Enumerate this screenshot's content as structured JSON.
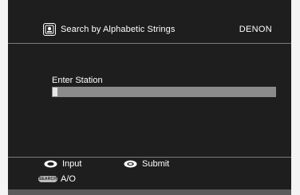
{
  "header": {
    "icon": "search-keypad-icon",
    "title": "Search by Alphabetic Strings",
    "brand": "DENON"
  },
  "form": {
    "label": "Enter Station",
    "value": ""
  },
  "footer": {
    "input_hint": {
      "icon": "rotary-dial-icon",
      "label": "Input"
    },
    "submit_hint": {
      "icon": "enter-button-icon",
      "label": "Submit"
    },
    "search_hint": {
      "icon_text": "SEARCH",
      "label": "A/O"
    }
  },
  "colors": {
    "screen_bg": "#1e1e1e",
    "bezel": "#5b5b5b",
    "text": "#ffffff",
    "input_field": "#8b8b8b",
    "divider": "#7a7a7a"
  }
}
